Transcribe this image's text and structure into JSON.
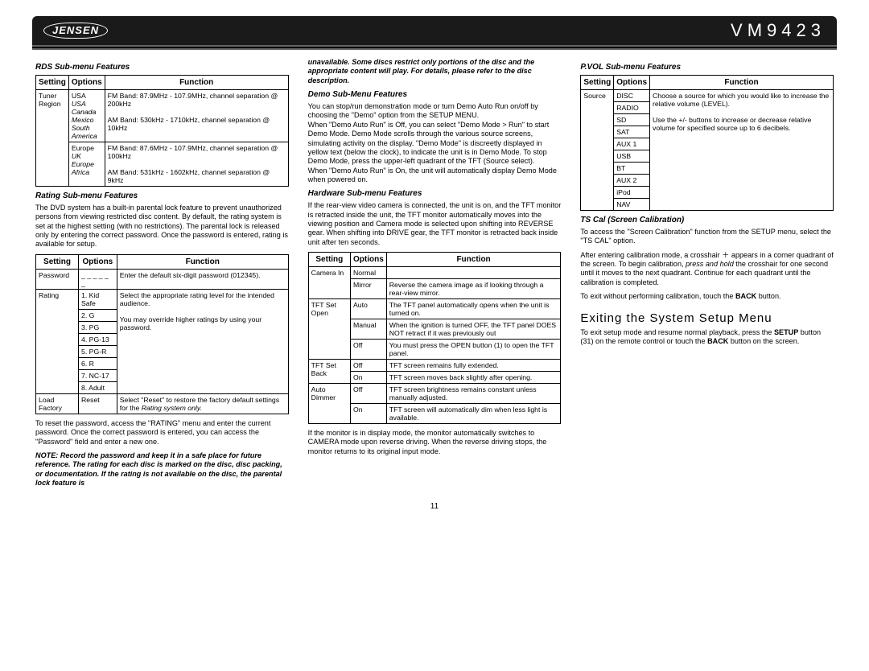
{
  "header": {
    "logo_text": "JENSEN",
    "model": "VM9423"
  },
  "page_number": "11",
  "col1": {
    "rds_title": "RDS Sub-menu Features",
    "th": {
      "setting": "Setting",
      "options": "Options",
      "function": "Function"
    },
    "rds": {
      "setting": "Tuner\nRegion",
      "opt1": "USA",
      "opt1_sub": "USA\nCanada\nMexico\nSouth\nAmerica",
      "func1": "FM Band: 87.9MHz - 107.9MHz, channel separation @ 200kHz\n\nAM Band: 530kHz - 1710kHz, channel separation @ 10kHz",
      "opt2": "Europe",
      "opt2_sub": "UK\nEurope\nAfrica",
      "func2": "FM Band: 87.6MHz - 107.9MHz, channel separation @ 100kHz\n\nAM Band: 531kHz - 1602kHz, channel separation @ 9kHz"
    },
    "rating_title": "Rating Sub-menu Features",
    "rating_intro": "The DVD system has a built-in parental lock feature to prevent unauthorized persons from viewing restricted disc content. By default, the rating system is set at the highest setting (with no restrictions). The parental lock is released only by entering the correct password. Once the password is entered, rating is available for setup.",
    "rating_tbl": {
      "r1s": "Password",
      "r1o": "_ _ _ _ _ _",
      "r1f": "Enter the default six-digit password (012345).",
      "r2s": "Rating",
      "r2o1": "1. Kid Safe",
      "r2o2": "2. G",
      "r2o3": "3. PG",
      "r2o4": "4. PG-13",
      "r2o5": "5. PG-R",
      "r2o6": "6. R",
      "r2o7": "7. NC-17",
      "r2o8": "8. Adult",
      "r2f": "Select the appropriate rating level for the intended audience.\n\nYou may override higher ratings by using your password.",
      "r3s": "Load Factory",
      "r3o": "Reset",
      "r3f_a": "Select \"Reset\" to restore the factory default settings for the ",
      "r3f_b": "Rating system only."
    },
    "reset_para": "To reset the password, access the \"RATING\" menu and enter the current password. Once the correct password is entered, you can access the \"Password\" field and enter a new one.",
    "note1": "NOTE: Record the password and keep it in a safe place for future reference. The rating for each disc is marked on the disc, disc packing, or documentation. If the rating is not available on the disc, the parental lock feature is"
  },
  "col2": {
    "cont_note": "unavailable. Some discs restrict only portions of the disc and the appropriate content will play. For details, please refer to the disc description.",
    "demo_title": "Demo Sub-Menu Features",
    "demo_para": "You can stop/run demonstration mode or turn Demo Auto Run on/off by choosing the \"Demo\" option from the SETUP MENU.\nWhen \"Demo Auto Run\" is Off, you can select \"Demo Mode > Run\" to start Demo Mode. Demo Mode scrolls through the various source screens, simulating activity on the display. \"Demo Mode\" is discreetly displayed in yellow text (below the clock), to indicate the unit is in Demo Mode. To stop Demo Mode, press the upper-left quadrant of the TFT (Source select).\nWhen \"Demo Auto Run\" is On, the unit will automatically display Demo Mode when powered on.",
    "hw_title": "Hardware Sub-menu Features",
    "hw_intro": "If the rear-view video camera is connected, the unit is on, and the TFT monitor is retracted inside the unit, the TFT monitor automatically moves into the viewing position and Camera mode is selected upon shifting into REVERSE gear. When shifting into DRIVE gear, the TFT monitor is retracted back inside unit after ten seconds.",
    "th": {
      "setting": "Setting",
      "options": "Options",
      "function": "Function"
    },
    "hw_tbl": {
      "r1s": "Camera In",
      "r1o1": "Normal",
      "r1f1": "",
      "r1o2": "Mirror",
      "r1f2": "Reverse the camera image as if looking through a rear-view mirror.",
      "r2s": "TFT Set Open",
      "r2o1": "Auto",
      "r2f1": "The TFT panel automatically opens when the unit is turned on.",
      "r2o2": "Manual",
      "r2f2": "When the ignition is turned OFF, the TFT panel DOES NOT retract if it was previously out",
      "r2o3": "Off",
      "r2f3": "You must press the OPEN button (1) to open the TFT panel.",
      "r3s": "TFT Set Back",
      "r3o1": "Off",
      "r3f1": "TFT screen remains fully extended.",
      "r3o2": "On",
      "r3f2": "TFT screen moves back slightly after opening.",
      "r4s": "Auto Dimmer",
      "r4o1": "Off",
      "r4f1": "TFT screen brightness remains constant unless manually adjusted.",
      "r4o2": "On",
      "r4f2": "TFT screen will automatically dim when less light is available."
    },
    "hw_outro": "If the monitor is in display mode, the monitor automatically switches to CAMERA mode upon reverse driving. When the reverse driving stops, the monitor returns to its original input mode."
  },
  "col3": {
    "pvol_title": "P.VOL Sub-menu Features",
    "th": {
      "setting": "Setting",
      "options": "Options",
      "function": "Function"
    },
    "pvol_tbl": {
      "s": "Source",
      "o1": "DISC",
      "o2": "RADIO",
      "o3": "SD",
      "o4": "SAT",
      "o5": "AUX 1",
      "o6": "USB",
      "o7": "BT",
      "o8": "AUX 2",
      "o9": "iPod",
      "o10": "NAV",
      "func": "Choose a source for which you would like to increase the relative volume (LEVEL).\n\nUse the +/- buttons to increase or decrease relative volume for specified source up to 6 decibels."
    },
    "tscal_title": "TS Cal (Screen Calibration)",
    "tscal_p1": "To access the \"Screen Calibration\" function from the SETUP menu, select the \"TS CAL\" option.",
    "tscal_p2a": "After entering calibration mode, a crosshair ",
    "tscal_p2b": " appears in a corner quadrant of the screen. To begin calibration, ",
    "tscal_p2c": "press and hold",
    "tscal_p2d": " the crosshair for one second until it moves to the next quadrant. Continue for each quadrant until the calibration is completed.",
    "tscal_p3a": "To exit without performing calibration, touch the ",
    "tscal_p3b": "BACK",
    "tscal_p3c": " button.",
    "exit_heading": "Exiting the System Setup Menu",
    "exit_p_a": "To exit setup mode and resume normal playback, press the ",
    "exit_p_b": "SETUP",
    "exit_p_c": " button (31) on the remote control or touch the ",
    "exit_p_d": "BACK",
    "exit_p_e": " button on the screen."
  }
}
